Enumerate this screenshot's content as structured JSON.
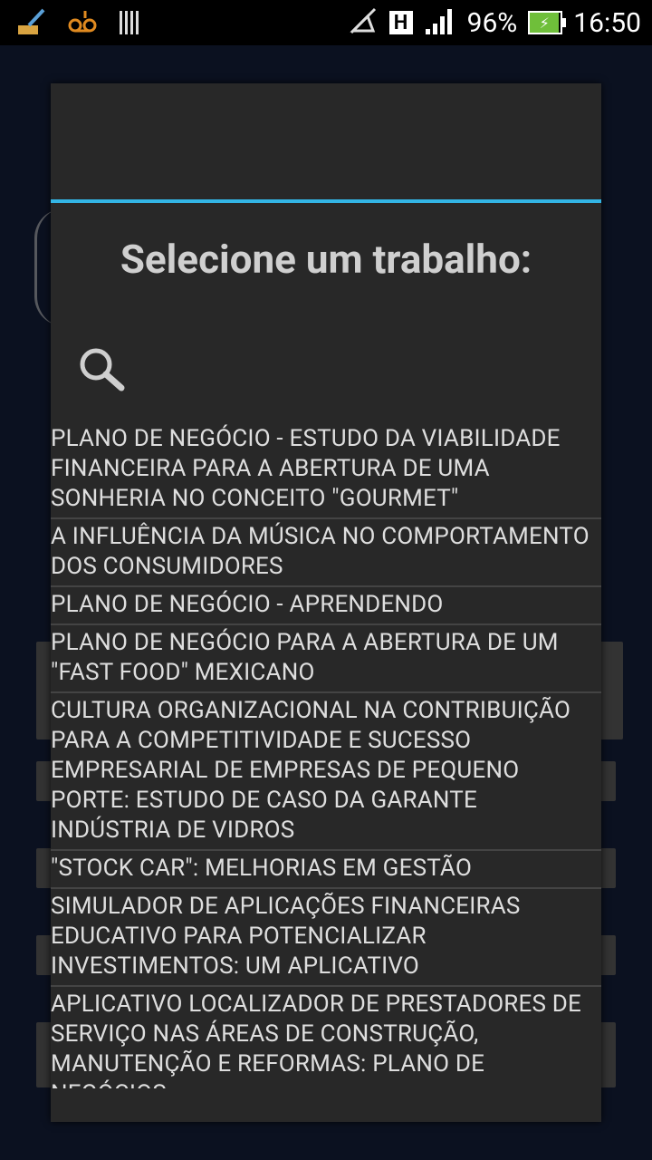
{
  "status_bar": {
    "left_icons": [
      "broom-icon",
      "voicemail-icon",
      "barcode-icon"
    ],
    "right_icons": [
      "mute-icon",
      "h-network-icon",
      "signal-icon",
      "battery-charging-icon"
    ],
    "network_type": "H",
    "battery": "96%",
    "time": "16:50"
  },
  "dialog": {
    "title": "Selecione um trabalho:",
    "search_icon": "search-icon",
    "items": [
      "PLANO DE NEGÓCIO - ESTUDO DA VIABILIDADE FINANCEIRA PARA A ABERTURA DE UMA SONHERIA NO CONCEITO \"GOURMET\"",
      "A INFLUÊNCIA DA MÚSICA NO COMPORTAMENTO DOS CONSUMIDORES",
      "PLANO DE NEGÓCIO - APRENDENDO",
      "PLANO DE NEGÓCIO PARA A ABERTURA DE UM \"FAST FOOD\" MEXICANO",
      "CULTURA ORGANIZACIONAL NA CONTRIBUIÇÃO PARA A COMPETITIVIDADE E SUCESSO EMPRESARIAL DE EMPRESAS DE PEQUENO PORTE: ESTUDO DE CASO DA GARANTE INDÚSTRIA DE VIDROS",
      "\"STOCK CAR\": MELHORIAS EM GESTÃO",
      "SIMULADOR DE APLICAÇÕES FINANCEIRAS EDUCATIVO PARA POTENCIALIZAR INVESTIMENTOS: UM APLICATIVO",
      "APLICATIVO LOCALIZADOR DE PRESTADORES DE SERVIÇO NAS ÁREAS DE CONSTRUÇÃO, MANUTENÇÃO E REFORMAS: PLANO DE NEGÓCIOS"
    ]
  },
  "colors": {
    "accent": "#33b5e5",
    "dialog_bg": "#282828",
    "background": "#0b1120"
  }
}
